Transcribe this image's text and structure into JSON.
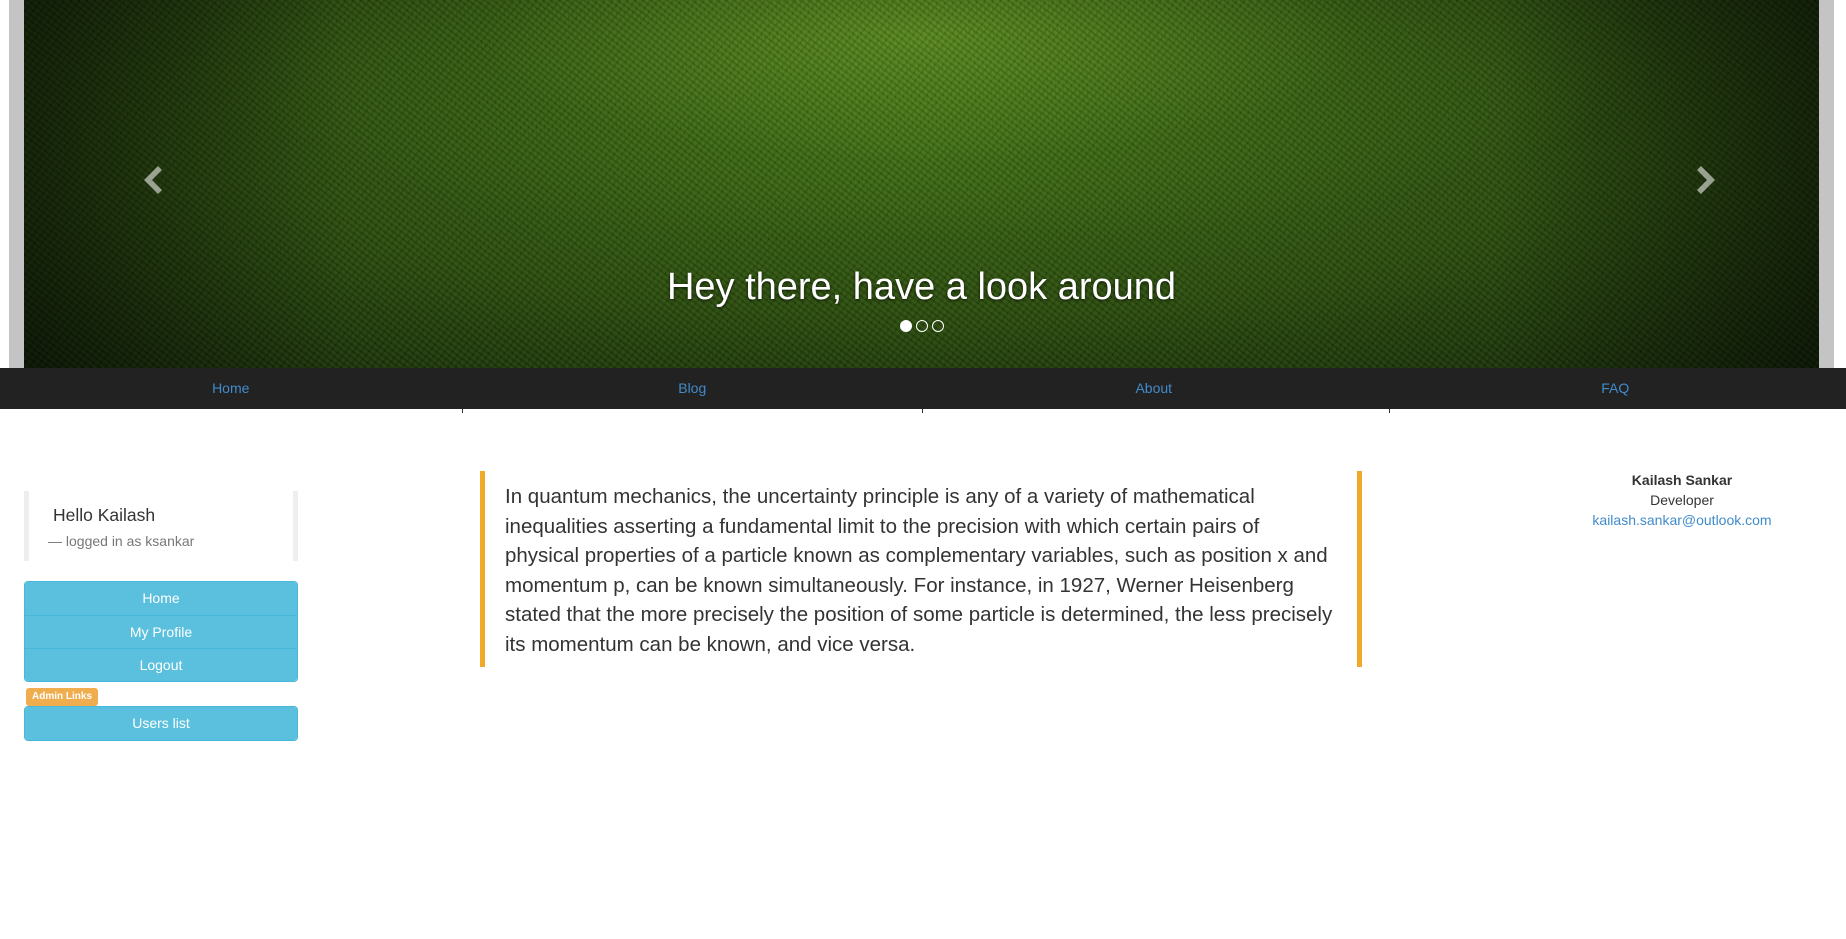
{
  "carousel": {
    "caption": "Hey there, have a look around",
    "prev_icon": "chevron-left-icon",
    "next_icon": "chevron-right-icon",
    "slides_count": 3,
    "active_slide": 1
  },
  "navbar": {
    "items": [
      {
        "label": "Home"
      },
      {
        "label": "Blog"
      },
      {
        "label": "About"
      },
      {
        "label": "FAQ"
      }
    ]
  },
  "sidebar": {
    "greeting": "Hello Kailash",
    "logged_in": "— logged in as ksankar",
    "menu": [
      {
        "label": "Home"
      },
      {
        "label": "My Profile"
      },
      {
        "label": "Logout"
      }
    ],
    "admin_label": "Admin Links",
    "admin_menu": [
      {
        "label": "Users list"
      }
    ]
  },
  "main": {
    "quote": "In quantum mechanics, the uncertainty principle is any of a variety of mathematical inequalities asserting a fundamental limit to the precision with which certain pairs of physical properties of a particle known as complementary variables, such as position x and momentum p, can be known simultaneously. For instance, in 1927, Werner Heisenberg stated that the more precisely the position of some particle is determined, the less precisely its momentum can be known, and vice versa."
  },
  "profile": {
    "name": "Kailash Sankar",
    "role": "Developer",
    "email": "kailash.sankar@outlook.com"
  },
  "colors": {
    "navbar_bg": "#222222",
    "link": "#428bca",
    "info": "#5bc0de",
    "warning": "#f0ad4e",
    "quote_border": "#f0a928"
  }
}
